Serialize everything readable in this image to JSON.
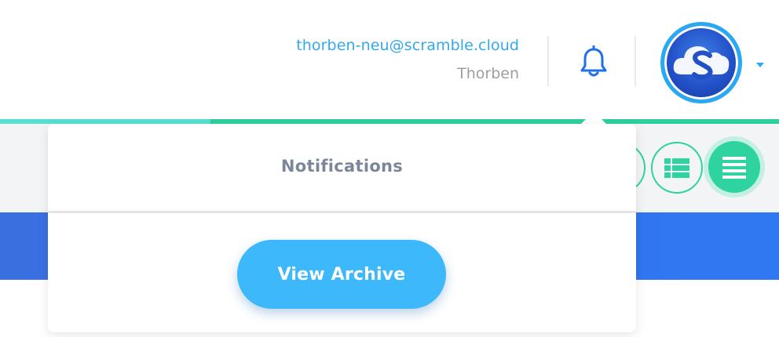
{
  "header": {
    "user_email": "thorben-neu@scramble.cloud",
    "user_name": "Thorben",
    "notifications_icon": "bell-icon",
    "avatar_icon": "scramble-cloud-logo",
    "account_menu_icon": "caret-down-icon"
  },
  "progress": {
    "fraction": 0.27,
    "fill_color": "#55e0cf",
    "track_color": "#2ecf9e"
  },
  "toolbar": {
    "view_buttons": [
      {
        "icon": "view-option-icon",
        "active": false
      },
      {
        "icon": "grid-view-icon",
        "active": false
      },
      {
        "icon": "list-view-icon",
        "active": true
      }
    ]
  },
  "notifications_panel": {
    "title": "Notifications",
    "archive_button_label": "View Archive"
  },
  "colors": {
    "accent_blue": "#32a9ec",
    "accent_green": "#2ed3a0",
    "button_blue": "#3db8fb",
    "band_blue": "#2f78f3"
  }
}
